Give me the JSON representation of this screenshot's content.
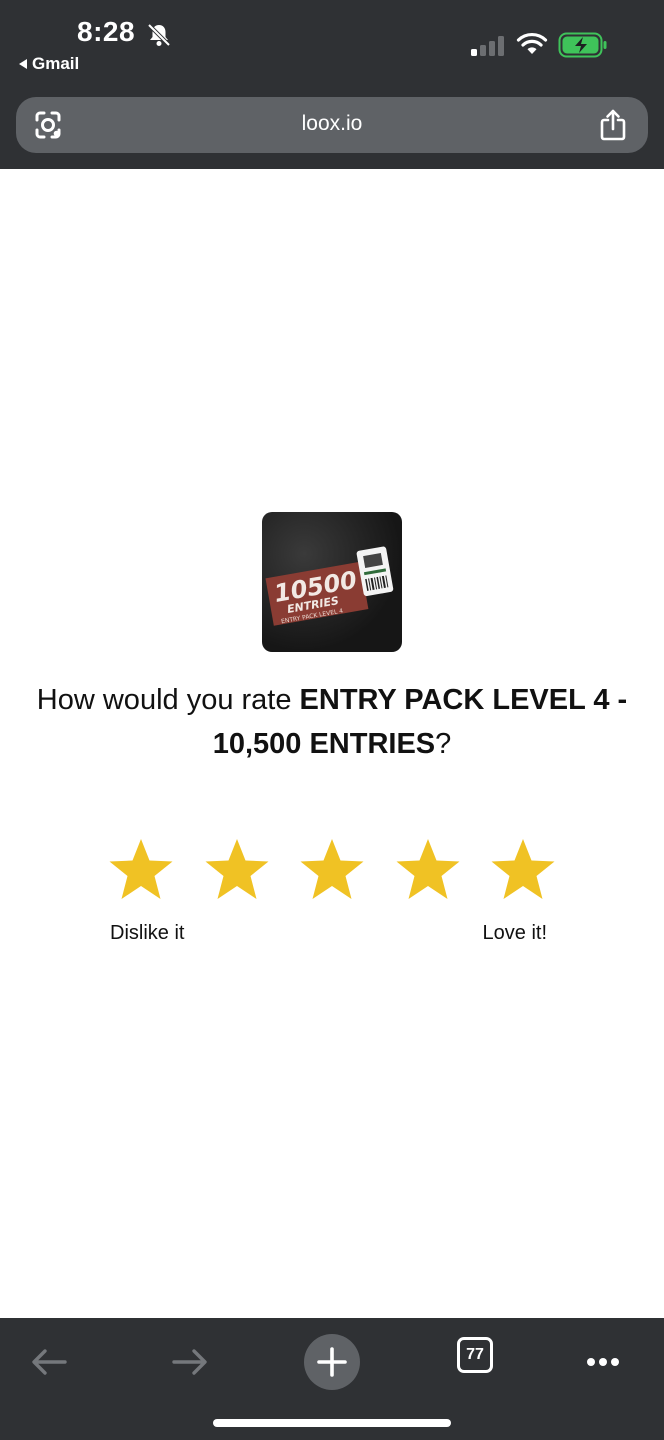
{
  "status_bar": {
    "time": "8:28",
    "back_app": "Gmail",
    "icons": [
      "bell-off-icon",
      "signal-icon",
      "wifi-icon",
      "battery-charging-icon"
    ]
  },
  "browser": {
    "address": "loox.io",
    "tab_count": "77"
  },
  "product": {
    "image_text": "10500",
    "image_subtext": "ENTRIES",
    "image_caption": "ENTRY PACK LEVEL 4"
  },
  "rating": {
    "question_prefix": "How would you rate ",
    "product_name": "ENTRY PACK LEVEL 4 - 10,500 ENTRIES",
    "question_suffix": "?",
    "stars": 5,
    "star_color": "#f0c224",
    "low_label": "Dislike it",
    "high_label": "Love it!"
  },
  "colors": {
    "chrome_bg": "#2f3134",
    "address_bg": "#5f6266",
    "battery_green": "#3fc35a"
  }
}
